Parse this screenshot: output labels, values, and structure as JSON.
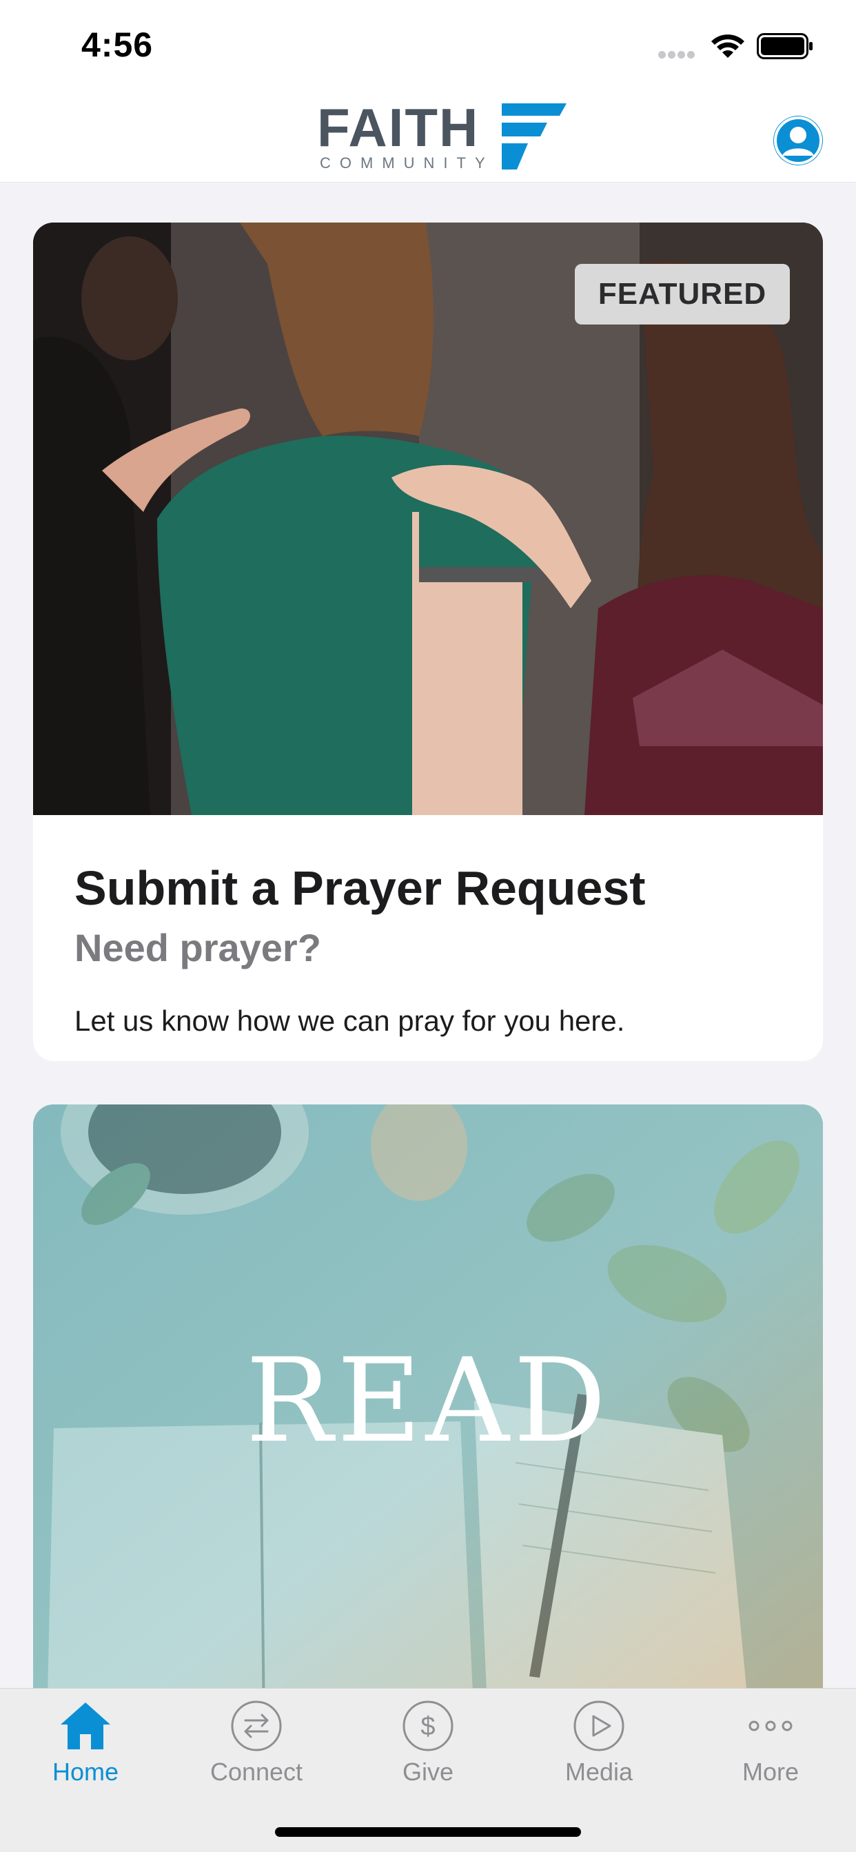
{
  "status_bar": {
    "time": "4:56"
  },
  "header": {
    "logo": {
      "wordmark": "FAITH",
      "tagline": "COMMUNITY"
    },
    "profile_icon": "person-icon",
    "brand_color": "#0b8fd4"
  },
  "feed": {
    "cards": [
      {
        "badge": "FEATURED",
        "title": "Submit a Prayer Request",
        "subtitle": "Need prayer?",
        "description": "Let us know how we can pray for you here."
      },
      {
        "image_text": "READ"
      }
    ]
  },
  "tab_bar": {
    "items": [
      {
        "label": "Home",
        "icon": "home-icon",
        "active": true
      },
      {
        "label": "Connect",
        "icon": "connect-arrows-icon",
        "active": false
      },
      {
        "label": "Give",
        "icon": "dollar-icon",
        "active": false
      },
      {
        "label": "Media",
        "icon": "play-icon",
        "active": false
      },
      {
        "label": "More",
        "icon": "more-dots-icon",
        "active": false
      }
    ],
    "active_color": "#0b8fd4",
    "inactive_color": "#8e8e93"
  }
}
